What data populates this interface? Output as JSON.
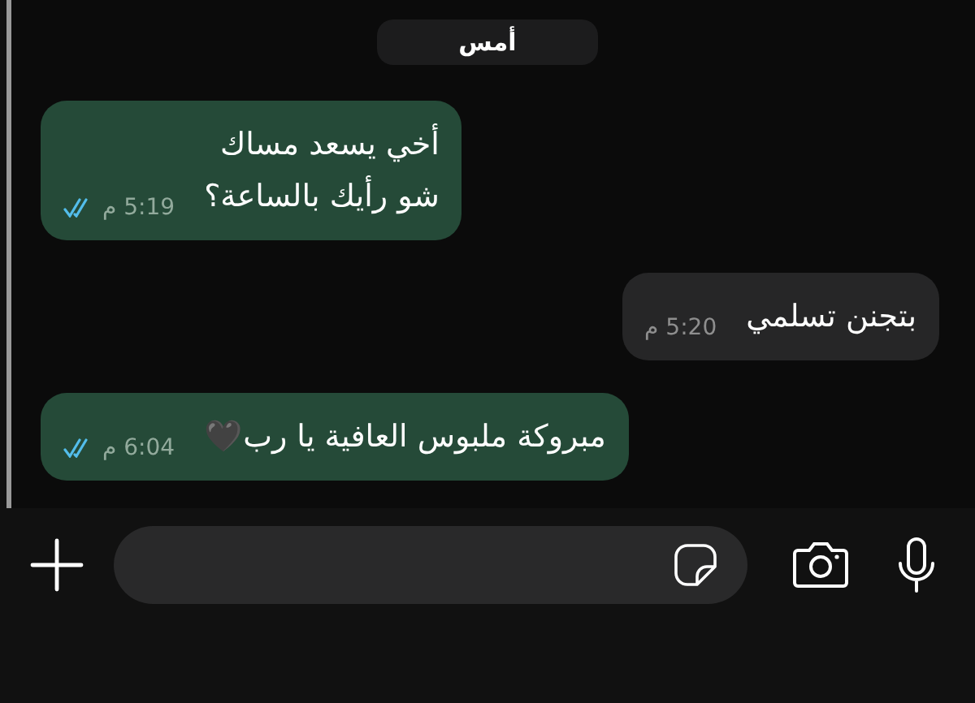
{
  "date_separator": "أمس",
  "messages": [
    {
      "text": "أخي يسعد مساك\nشو رأيك بالساعة؟",
      "time": "5:19 م",
      "outgoing": true,
      "read": true
    },
    {
      "text": "بتجنن تسلمي",
      "time": "5:20 م",
      "outgoing": false
    },
    {
      "text": "مبروكة ملبوس العافية يا رب🖤",
      "time": "6:04 م",
      "outgoing": true,
      "read": true
    }
  ]
}
